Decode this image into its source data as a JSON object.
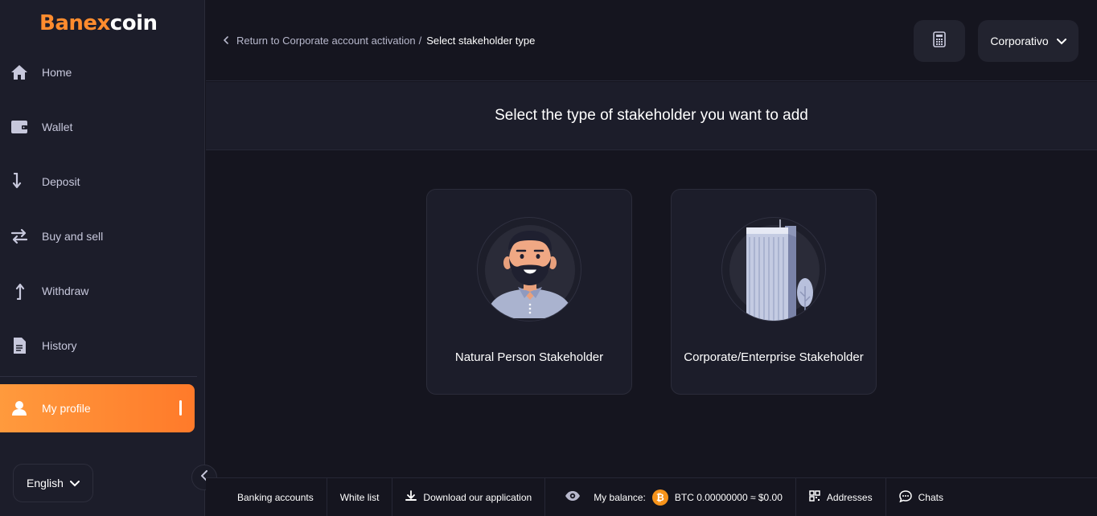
{
  "app": {
    "logo_b": "B",
    "logo_banex": "anex",
    "logo_coin": "coin"
  },
  "sidebar": {
    "items": [
      {
        "label": "Home",
        "icon": "home-icon"
      },
      {
        "label": "Wallet",
        "icon": "wallet-icon"
      },
      {
        "label": "Deposit",
        "icon": "arrow-down-icon"
      },
      {
        "label": "Buy and sell",
        "icon": "swap-icon"
      },
      {
        "label": "Withdraw",
        "icon": "arrow-up-icon"
      },
      {
        "label": "History",
        "icon": "document-icon"
      }
    ],
    "active_item": {
      "label": "My profile",
      "icon": "user-icon"
    },
    "language": "English"
  },
  "header": {
    "breadcrumb_back": "Return to Corporate account activation",
    "breadcrumb_separator": "/",
    "breadcrumb_current": "Select stakeholder type",
    "account_label": "Corporativo"
  },
  "main": {
    "title": "Select the type of stakeholder you want to add",
    "cards": [
      {
        "label": "Natural Person Stakeholder",
        "icon": "person-avatar-icon"
      },
      {
        "label": "Corporate/Enterprise Stakeholder",
        "icon": "building-icon"
      }
    ]
  },
  "footer": {
    "banking_accounts": "Banking accounts",
    "white_list": "White list",
    "download_app": "Download our application",
    "balance_label": "My balance:",
    "btc_symbol": "₿",
    "balance_value": "BTC 0.00000000 ≈ $0.00",
    "addresses": "Addresses",
    "chats": "Chats"
  },
  "colors": {
    "accent": "#ff8c2e",
    "background": "#15151f",
    "sidebar": "#1c1d2a"
  }
}
